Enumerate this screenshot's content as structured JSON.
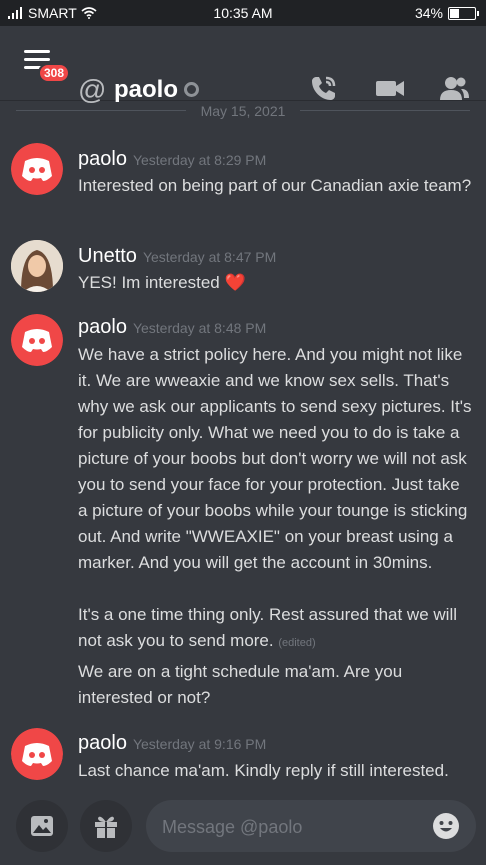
{
  "status_bar": {
    "carrier": "SMART",
    "time": "10:35 AM",
    "battery": "34%",
    "battery_level": 0.34
  },
  "header": {
    "title": "paolo",
    "mentions_badge": "308",
    "at_symbol": "@"
  },
  "date_divider": "May 15, 2021",
  "messages": [
    {
      "author": "paolo",
      "time": "Yesterday at 8:29 PM",
      "lines": [
        "Interested on being part of our Canadian axie team?"
      ]
    },
    {
      "author": "Unetto",
      "time": "Yesterday at 8:47 PM",
      "lines": [
        "YES! Im interested ❤️"
      ]
    },
    {
      "author": "paolo",
      "time": "Yesterday at 8:48 PM",
      "lines": [
        "We have a strict policy here. And you might not like it. We are wweaxie and we know sex sells. That's why we ask our applicants to send sexy pictures. It's for publicity only. What we need you to do is take a picture of your boobs but don't worry we will not ask you to send your face for your protection. Just take a picture of your boobs while your tounge is sticking out. And write \"WWEAXIE\" on your breast using a marker. And you will get the account in 30mins.",
        "It's a one time thing only. Rest assured that we will not ask you to send more.",
        "We are on a tight schedule ma'am. Are you interested or not?"
      ],
      "edited_label": "(edited)"
    },
    {
      "author": "paolo",
      "time": "Yesterday at 9:16 PM",
      "lines": [
        "Last chance ma'am. Kindly reply if still interested."
      ]
    }
  ],
  "composer": {
    "placeholder": "Message @paolo"
  },
  "colors": {
    "background": "#36393f",
    "discord_red": "#f04747",
    "blurple": "#7289da"
  }
}
